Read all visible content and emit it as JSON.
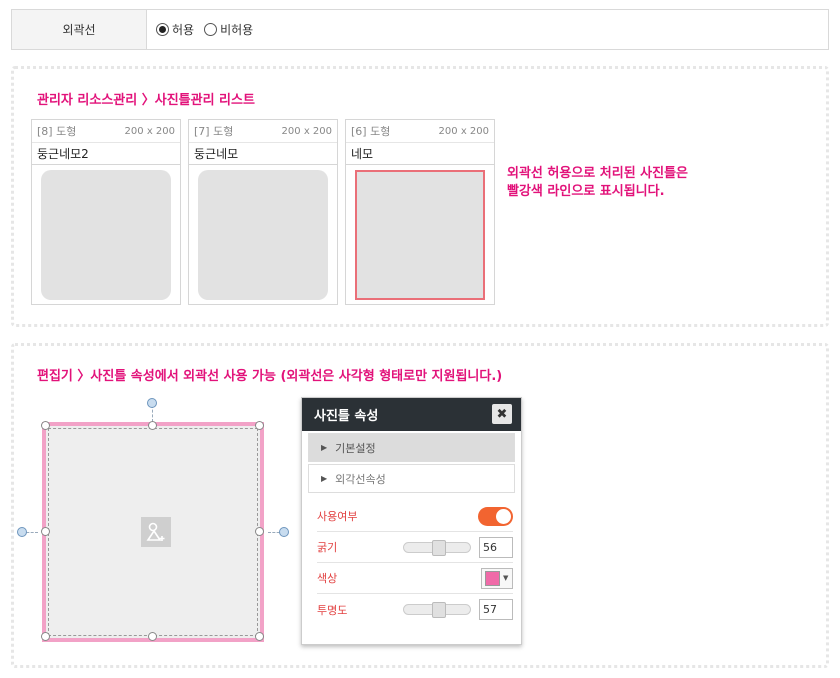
{
  "option": {
    "label": "외곽선",
    "choices": [
      {
        "label": "허용",
        "selected": true
      },
      {
        "label": "비허용",
        "selected": false
      }
    ]
  },
  "list_section": {
    "title": "관리자 리소스관리 〉사진틀관리 리스트",
    "cards": [
      {
        "num": "[8] 도형",
        "size": "200 x 200",
        "name": "둥근네모2",
        "shape": "rounded"
      },
      {
        "num": "[7] 도형",
        "size": "200 x 200",
        "name": "둥근네모",
        "shape": "rounded"
      },
      {
        "num": "[6] 도형",
        "size": "200 x 200",
        "name": "네모",
        "shape": "square-outlined"
      }
    ],
    "note_lines": [
      "외곽선 허용으로 처리된 사진틀은",
      "빨강색 라인으로 표시됩니다."
    ]
  },
  "editor_section": {
    "title": "편집기 〉사진틀 속성에서 외곽선 사용 가능 (외곽선은 사각형 형태로만 지원됩니다.)",
    "canvas": {
      "border_color": "#f2a2c7",
      "center_icon": "shapes-icon"
    },
    "panel": {
      "title": "사진틀 속성",
      "close_icon": "close-icon",
      "accordions": [
        {
          "label": "기본설정",
          "active": true
        },
        {
          "label": "외각선속성",
          "active": false
        }
      ],
      "props": {
        "use_label": "사용여부",
        "use_value": true,
        "thickness_label": "굵기",
        "thickness_value": "56",
        "thickness_level": 0.56,
        "color_label": "색상",
        "color_value": "#f06aa8",
        "opacity_label": "투명도",
        "opacity_value": "57",
        "opacity_level": 0.57
      }
    }
  },
  "colors": {
    "accent": "#e2127a",
    "toggle_on": "#f26430",
    "outline_red": "#ea6f78"
  }
}
